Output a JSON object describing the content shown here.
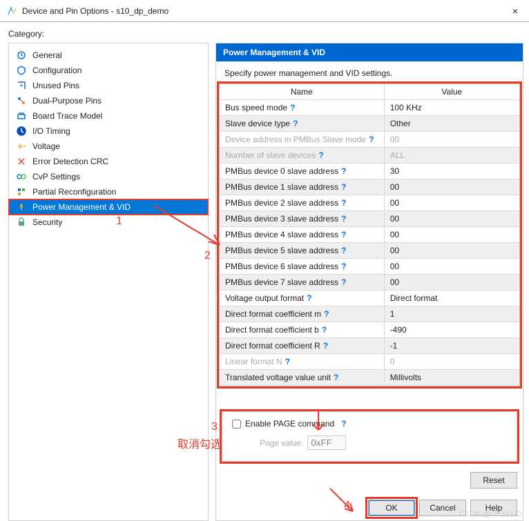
{
  "window": {
    "title": "Device and Pin Options - s10_dp_demo",
    "close": "×"
  },
  "category_label": "Category:",
  "sidebar": {
    "items": [
      {
        "label": "General"
      },
      {
        "label": "Configuration"
      },
      {
        "label": "Unused Pins"
      },
      {
        "label": "Dual-Purpose Pins"
      },
      {
        "label": "Board Trace Model"
      },
      {
        "label": "I/O Timing"
      },
      {
        "label": "Voltage"
      },
      {
        "label": "Error Detection CRC"
      },
      {
        "label": "CvP Settings"
      },
      {
        "label": "Partial Reconfiguration"
      },
      {
        "label": "Power Management & VID"
      },
      {
        "label": "Security"
      }
    ]
  },
  "main": {
    "header": "Power Management & VID",
    "subtitle": "Specify power management and VID settings.",
    "table_head": {
      "name": "Name",
      "value": "Value"
    },
    "rows": [
      {
        "name": "Bus speed mode",
        "value": "100 KHz",
        "help": true
      },
      {
        "name": "Slave device type",
        "value": "Other",
        "help": true
      },
      {
        "name": "Device address in PMBus Slave mode",
        "value": "00",
        "help": true,
        "disabled": true
      },
      {
        "name": "Number of slave devices",
        "value": "ALL",
        "help": true,
        "disabled": true
      },
      {
        "name": "PMBus device 0 slave address",
        "value": "30",
        "help": true
      },
      {
        "name": "PMBus device 1 slave address",
        "value": "00",
        "help": true
      },
      {
        "name": "PMBus device 2 slave address",
        "value": "00",
        "help": true
      },
      {
        "name": "PMBus device 3 slave address",
        "value": "00",
        "help": true
      },
      {
        "name": "PMBus device 4 slave address",
        "value": "00",
        "help": true
      },
      {
        "name": "PMBus device 5 slave address",
        "value": "00",
        "help": true
      },
      {
        "name": "PMBus device 6 slave address",
        "value": "00",
        "help": true
      },
      {
        "name": "PMBus device 7 slave address",
        "value": "00",
        "help": true
      },
      {
        "name": "Voltage output format",
        "value": "Direct format",
        "help": true
      },
      {
        "name": "Direct format coefficient m",
        "value": "1",
        "help": true
      },
      {
        "name": "Direct format coefficient b",
        "value": "-490",
        "help": true
      },
      {
        "name": "Direct format coefficient R",
        "value": "-1",
        "help": true
      },
      {
        "name": "Linear format N",
        "value": "0",
        "help": true,
        "disabled": true
      },
      {
        "name": "Translated voltage value unit",
        "value": "Millivolts",
        "help": true
      }
    ],
    "page": {
      "checkbox_label": "Enable PAGE command",
      "value_label": "Page value:",
      "value": "0xFF"
    },
    "buttons": {
      "reset": "Reset",
      "ok": "OK",
      "cancel": "Cancel",
      "help": "Help"
    }
  },
  "annotations": {
    "n1": "1",
    "n2": "2",
    "n3": "3",
    "n4": "4",
    "cancel_text": "取消勾选"
  },
  "watermark": "CSDN @GEXLUO"
}
